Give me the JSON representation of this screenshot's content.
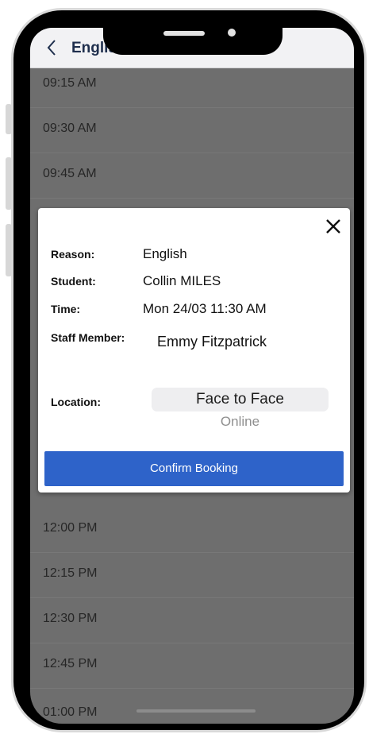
{
  "nav": {
    "title": "English"
  },
  "slots_top": [
    "09:15 AM",
    "09:30 AM",
    "09:45 AM"
  ],
  "slots_bottom": [
    "12:00 PM",
    "12:15 PM",
    "12:30 PM",
    "12:45 PM",
    "01:00 PM"
  ],
  "modal": {
    "reason_label": "Reason:",
    "reason_value": "English",
    "student_label": "Student:",
    "student_value": "Collin MILES",
    "time_label": "Time:",
    "time_value": "Mon 24/03 11:30 AM",
    "staff_label": "Staff Member:",
    "staff_value": "Emmy Fitzpatrick",
    "location_label": "Location:",
    "location_options": [
      "Face to Face",
      "Online"
    ],
    "location_selected": "Face to Face",
    "confirm_label": "Confirm Booking"
  },
  "colors": {
    "accent": "#2e63c9",
    "overlay": "#6e6e6e",
    "nav_title": "#1f2f4d"
  },
  "icons": {
    "back": "chevron-left-icon",
    "close": "close-icon"
  }
}
